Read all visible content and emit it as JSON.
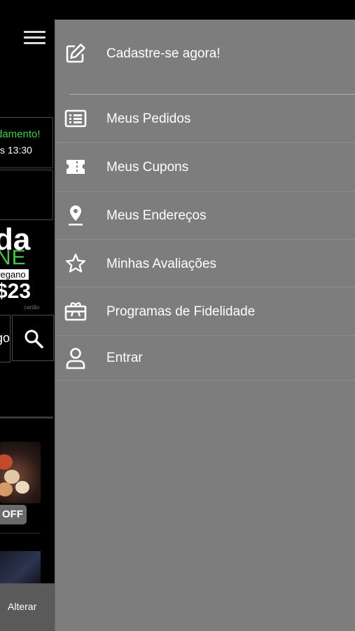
{
  "background": {
    "notice_title": "damento!",
    "notice_time": "s 13:30",
    "banner_big": "da",
    "banner_green": "NE",
    "banner_tag": "vegano",
    "banner_num": "$23",
    "banner_small": "cartão",
    "search_text": "go",
    "off_badge": "OFF",
    "alterar_label": "Alterar"
  },
  "drawer": {
    "items": [
      {
        "label": "Cadastre-se agora!",
        "icon": "edit-icon"
      },
      {
        "label": "Meus Pedidos",
        "icon": "list-icon"
      },
      {
        "label": "Meus Cupons",
        "icon": "ticket-icon"
      },
      {
        "label": "Meus Endereços",
        "icon": "location-pin-icon"
      },
      {
        "label": "Minhas Avaliações",
        "icon": "star-icon"
      },
      {
        "label": "Programas de Fidelidade",
        "icon": "gift-icon"
      },
      {
        "label": "Entrar",
        "icon": "user-icon"
      }
    ]
  },
  "colors": {
    "drawer_bg": "#7d7d7d",
    "accent_green": "#3fd04b",
    "text": "#ffffff"
  }
}
